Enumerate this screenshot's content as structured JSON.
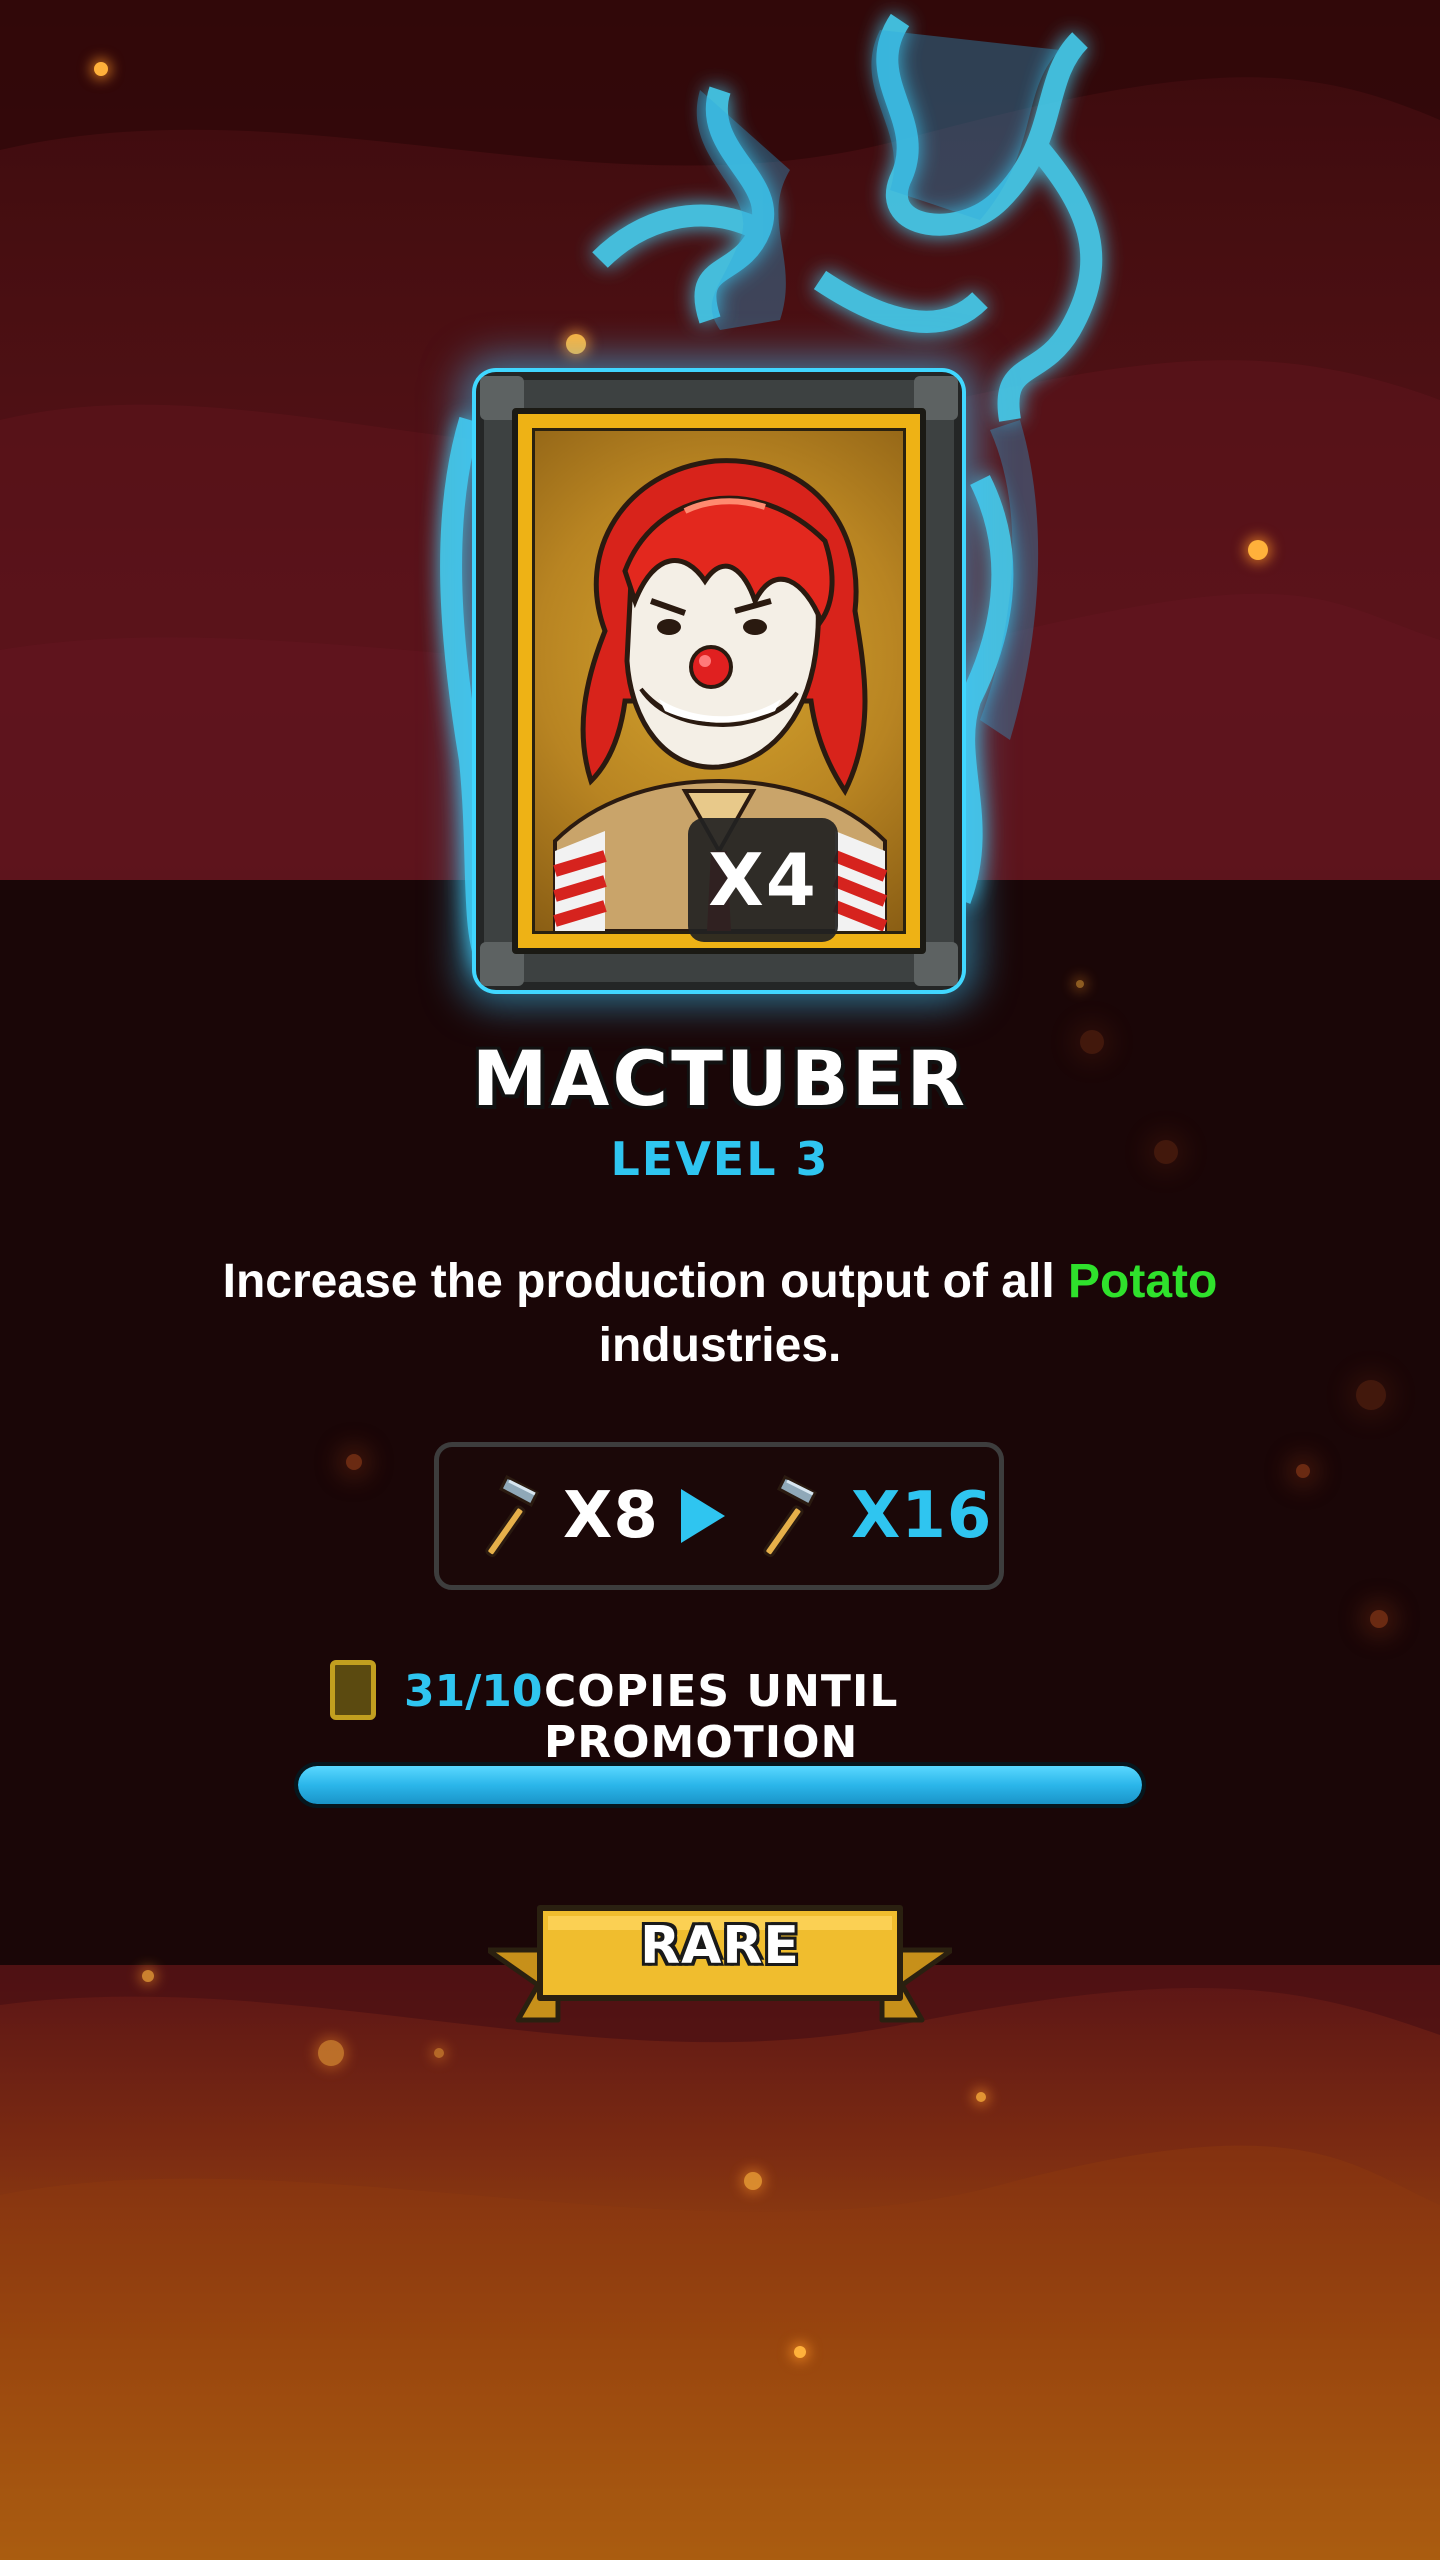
{
  "card": {
    "name": "MACTUBER",
    "level_label": "LEVEL 3",
    "count": "X4",
    "portrait_icon": "clown-portrait-icon"
  },
  "description": {
    "before": "Increase the production output of all",
    "highlight": "Potato",
    "after": "industries."
  },
  "boost": {
    "current": "X8",
    "next": "X16",
    "icon": "hammer-icon",
    "arrow_icon": "play-arrow-icon"
  },
  "copies": {
    "count": "31/10",
    "label": "COPIES UNTIL PROMOTION",
    "progress": 1.0
  },
  "rarity": {
    "label": "RARE"
  },
  "colors": {
    "accent_blue": "#2fc5f0",
    "highlight_green": "#2fe12c",
    "gold": "#eeb215",
    "flame_blue": "#44e0ff"
  }
}
